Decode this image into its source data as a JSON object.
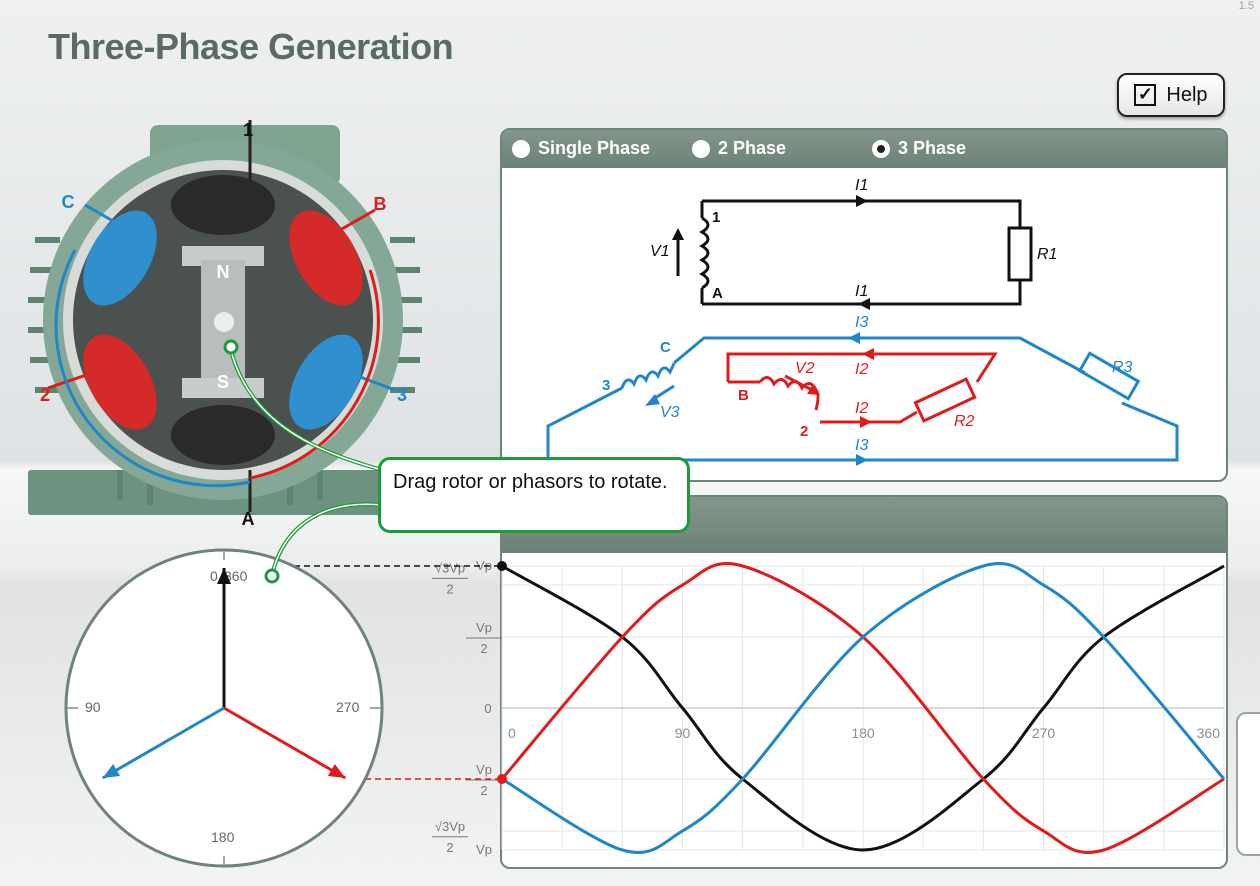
{
  "page": {
    "title": "Three-Phase Generation",
    "version": "1.5"
  },
  "help": {
    "label": "Help",
    "checked": true
  },
  "mode": {
    "options": [
      {
        "label": "Single Phase",
        "selected": false
      },
      {
        "label": "2 Phase",
        "selected": false
      },
      {
        "label": "3 Phase",
        "selected": true
      }
    ]
  },
  "generator": {
    "terminal_labels": [
      "1",
      "A",
      "B",
      "C",
      "2",
      "3"
    ],
    "rotor": {
      "north": "N",
      "south": "S"
    }
  },
  "callout": {
    "text": "Drag rotor or phasors to rotate."
  },
  "circuit": {
    "phase1": {
      "source": "V1",
      "resistor": "R1",
      "current_top": "I1",
      "current_bottom": "I1",
      "terminal_top": "1",
      "terminal_bottom": "A"
    },
    "phase2": {
      "source": "V2",
      "resistor": "R2",
      "current_top": "I2",
      "current_bottom": "I2",
      "terminal_top": "B",
      "terminal_bottom": "2"
    },
    "phase3": {
      "source": "V3",
      "resistor": "R3",
      "current_top": "I3",
      "current_bottom": "I3",
      "terminal_top": "C",
      "terminal_bottom": "3"
    }
  },
  "phasor": {
    "dial_labels": {
      "top": "0",
      "top2": "360",
      "left": "90",
      "right": "270",
      "bottom": "180"
    },
    "angles_deg": {
      "phase1": 0,
      "phase2": 240,
      "phase3": 120
    }
  },
  "colors": {
    "phase1": "#111111",
    "phase2": "#e01b1b",
    "phase3": "#1f86c8",
    "panel": "#75897f",
    "callout": "#1f9a3a"
  },
  "chart_data": {
    "type": "line",
    "x_ticks": [
      "0",
      "90",
      "180",
      "270",
      "360"
    ],
    "xlim": [
      0,
      360
    ],
    "ylim": [
      -1,
      1
    ],
    "y_tick_labels": {
      "top": "Vp",
      "upper_sqrt_num": "√3Vp",
      "upper_sqrt_den": "2",
      "upper_half_num": "Vp",
      "upper_half_den": "2",
      "zero": "0",
      "lower_half_num": "Vp",
      "lower_half_den": "2",
      "lower_sqrt_num": "√3Vp",
      "lower_sqrt_den": "2",
      "bottom": "Vp"
    },
    "series": [
      {
        "color": "#111111",
        "x": [
          0,
          60,
          90,
          120,
          180,
          240,
          270,
          300,
          360
        ],
        "y": [
          1,
          0.5,
          0,
          -0.5,
          -1,
          -0.5,
          0,
          0.5,
          1
        ]
      },
      {
        "color": "#e01b1b",
        "x": [
          0,
          60,
          90,
          120,
          180,
          240,
          270,
          300,
          360
        ],
        "y": [
          -0.5,
          0.5,
          0.866,
          1,
          0.5,
          -0.5,
          -0.866,
          -1,
          -0.5
        ]
      },
      {
        "color": "#1f86c8",
        "x": [
          0,
          60,
          90,
          120,
          180,
          240,
          270,
          300,
          360
        ],
        "y": [
          -0.5,
          -1,
          -0.866,
          -0.5,
          0.5,
          1,
          0.866,
          0.5,
          -0.5
        ]
      }
    ]
  }
}
